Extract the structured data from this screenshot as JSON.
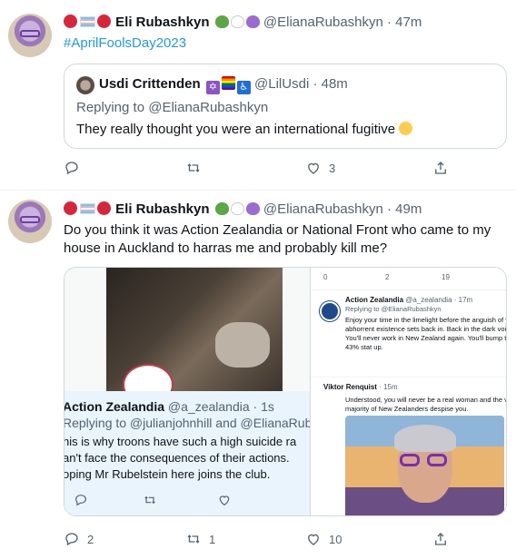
{
  "tweet1": {
    "author_name": "Eli Rubashkyn",
    "handle": "@ElianaRubashkyn",
    "time": "· 47m",
    "hashtag": "#AprilFoolsDay2023",
    "quote": {
      "author_name": "Usdi Crittenden",
      "handle": "@LilUsdi",
      "time": "· 48m",
      "replying": "Replying to @ElianaRubashkyn",
      "text": "They really thought you were an international fugitive"
    },
    "actions": {
      "replies": "",
      "retweets": "",
      "likes": "3",
      "share": ""
    }
  },
  "tweet2": {
    "author_name": "Eli Rubashkyn",
    "handle": "@ElianaRubashkyn",
    "time": "· 49m",
    "text": "Do you think it was Action Zealandia or National Front who came to my house in Auckland to harras me and probably kill me?",
    "media": {
      "inner_tweet": {
        "name": "Action Zealandia",
        "handle": "@a_zealandia",
        "time": "· 1s",
        "replying": "Replying to @julianjohnhill and @ElianaRuba",
        "lines": [
          "his is why troons have such a high suicide ra",
          "an't face the consequences of their actions.",
          "oping Mr Rubelstein here joins the club."
        ]
      },
      "right_panel": {
        "top_counts": [
          "0",
          "2",
          "19"
        ],
        "tweet1_name": "Action Zealandia",
        "tweet1_handle": "@a_zealandia · 17m",
        "tweet1_replying": "Replying to @ElianaRubashkyn",
        "tweet1_lines": [
          "Enjoy your time in the limelight before the anguish of your",
          "abhorrent existence sets back in. Back in the dark void.",
          "You'll never work in New Zealand again. You'll bump that",
          "43% stat up."
        ],
        "tweet2_name": "Viktor Renquist",
        "tweet2_time": "· 15m",
        "tweet2_lines": [
          "Understood, you will never be a real woman and the vast",
          "majority of New Zealanders despise you."
        ]
      }
    },
    "actions": {
      "replies": "2",
      "retweets": "1",
      "likes": "10",
      "share": ""
    }
  }
}
